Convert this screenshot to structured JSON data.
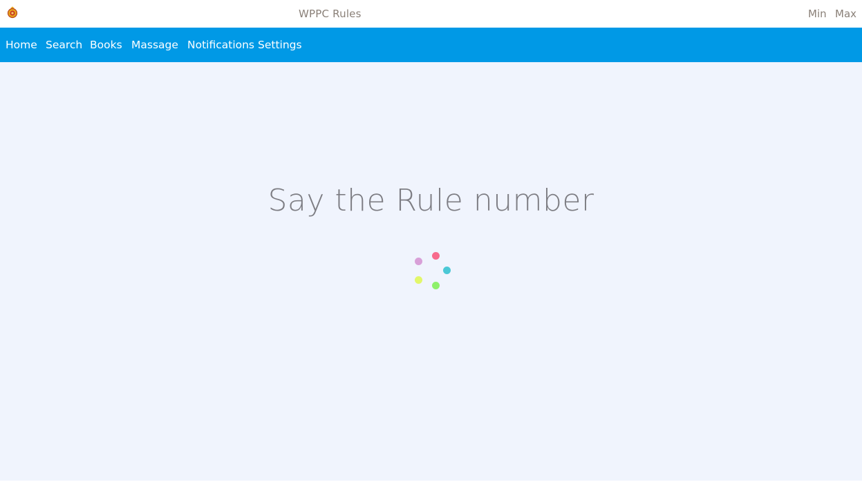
{
  "window": {
    "title": "WPPC Rules",
    "min_label": "Min",
    "max_label": "Max"
  },
  "nav": {
    "items": [
      "Home",
      "Search",
      "Books",
      "Massage",
      "Notifications",
      "Settings"
    ]
  },
  "main": {
    "prompt": "Say the Rule number"
  },
  "colors": {
    "nav_bg": "#0099e6",
    "page_bg": "#f0f4fd",
    "spinner": [
      "#f76a8c",
      "#4bc8d6",
      "#8ef06a",
      "#e2f76a",
      "#d8a0d8"
    ]
  },
  "icons": {
    "logo": "emblem-icon",
    "spinner": "loading-spinner"
  }
}
